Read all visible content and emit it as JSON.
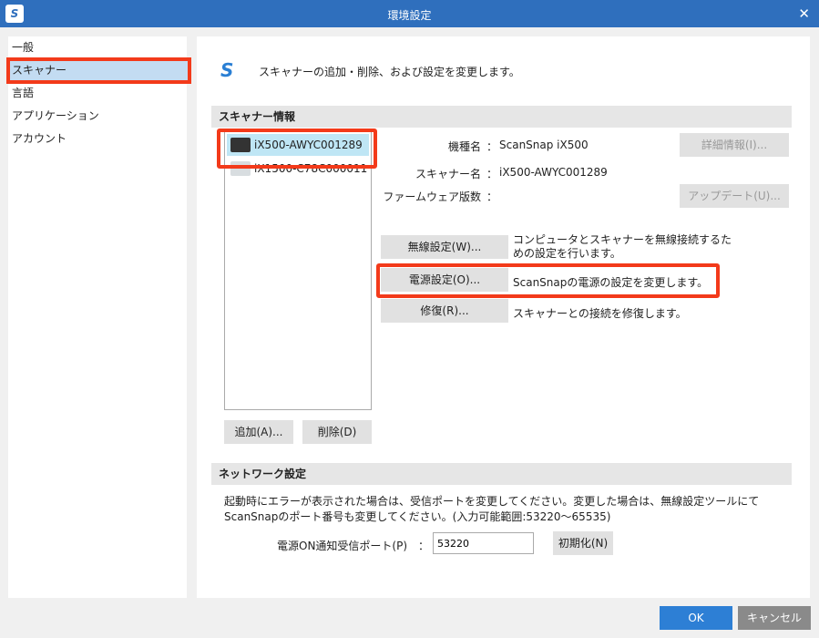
{
  "window": {
    "title": "環境設定",
    "logo": "S"
  },
  "sidebar": {
    "items": [
      {
        "label": "一般"
      },
      {
        "label": "スキャナー"
      },
      {
        "label": "言語"
      },
      {
        "label": "アプリケーション"
      },
      {
        "label": "アカウント"
      }
    ]
  },
  "main": {
    "intro": "スキャナーの追加・削除、および設定を変更します。",
    "scanner_info": {
      "header": "スキャナー情報",
      "scanners": [
        {
          "name": "iX500-AWYC001289"
        },
        {
          "name": "iX1500-C78C000011"
        }
      ],
      "model_label": "機種名",
      "model_value": "ScanSnap iX500",
      "name_label": "スキャナー名",
      "name_value": "iX500-AWYC001289",
      "firmware_label": "ファームウェア版数",
      "firmware_value": "",
      "colon": "：",
      "details_button": "詳細情報(I)...",
      "update_button": "アップデート(U)...",
      "wireless_button": "無線設定(W)...",
      "wireless_desc": "コンピュータとスキャナーを無線接続するための設定を行います。",
      "power_button": "電源設定(O)...",
      "power_desc": "ScanSnapの電源の設定を変更します。",
      "repair_button": "修復(R)...",
      "repair_desc": "スキャナーとの接続を修復します。",
      "add_button": "追加(A)...",
      "delete_button": "削除(D)"
    },
    "network": {
      "header": "ネットワーク設定",
      "desc": "起動時にエラーが表示された場合は、受信ポートを変更してください。変更した場合は、無線設定ツールにてScanSnapのポート番号も変更してください。(入力可能範囲:53220～65535)",
      "port_label": "電源ON通知受信ポート(P)　：",
      "port_value": "53220",
      "reset_button": "初期化(N)"
    }
  },
  "footer": {
    "ok": "OK",
    "cancel": "キャンセル"
  }
}
